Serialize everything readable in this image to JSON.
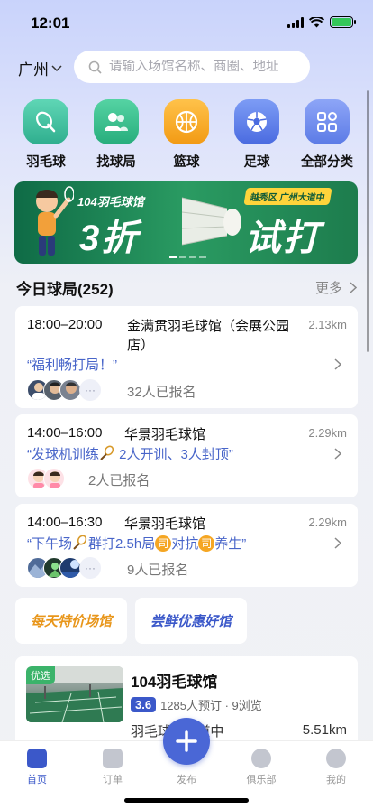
{
  "status": {
    "time": "12:01"
  },
  "header": {
    "city": "广州",
    "search_placeholder": "请输入场馆名称、商圈、地址"
  },
  "categories": [
    {
      "label": "羽毛球",
      "icon": "shuttlecock-icon",
      "color": "#3fc2a3"
    },
    {
      "label": "找球局",
      "icon": "people-icon",
      "color": "#33c08f"
    },
    {
      "label": "篮球",
      "icon": "basketball-icon",
      "color": "#f5a623"
    },
    {
      "label": "足球",
      "icon": "soccer-icon",
      "color": "#5b7fe8"
    },
    {
      "label": "全部分类",
      "icon": "grid-icon",
      "color": "#6b8af0"
    }
  ],
  "banner": {
    "title": "104羽毛球馆",
    "big1": "3折",
    "big2": "试打",
    "tag": "越秀区 广州大道中"
  },
  "section": {
    "title": "今日球局(252)",
    "more": "更多"
  },
  "games": [
    {
      "time": "18:00–20:00",
      "venue": "金满贯羽毛球馆（会展公园店）",
      "distance": "2.13km",
      "desc": "“福利畅打局！”",
      "signed": "32人已报名"
    },
    {
      "time": "14:00–16:00",
      "venue": "华景羽毛球馆",
      "distance": "2.29km",
      "desc_parts": [
        "“发球机训练",
        "2人开训、3人封顶”"
      ],
      "signed": "2人已报名"
    },
    {
      "time": "14:00–16:30",
      "venue": "华景羽毛球馆",
      "distance": "2.29km",
      "desc_parts": [
        "“下午场",
        "群打2.5h局",
        "对抗",
        "养生”"
      ],
      "badge": "司",
      "signed": "9人已报名"
    }
  ],
  "avatar_more": "···",
  "promos": [
    "每天特价场馆",
    "尝鲜优惠好馆"
  ],
  "venue": {
    "tag": "优选",
    "name": "104羽毛球馆",
    "rating": "3.6",
    "stats": "1285人预订 · 9浏览",
    "sub": "羽毛球 · 大道中",
    "distance": "5.51km"
  },
  "tabbar": [
    {
      "label": "首页",
      "active": true
    },
    {
      "label": "订单",
      "active": false
    },
    {
      "label": "发布",
      "active": false
    },
    {
      "label": "俱乐部",
      "active": false
    },
    {
      "label": "我的",
      "active": false
    }
  ],
  "colors": {
    "accent": "#3b58c9",
    "desc_blue": "#4865c9",
    "orange": "#f5a623"
  }
}
